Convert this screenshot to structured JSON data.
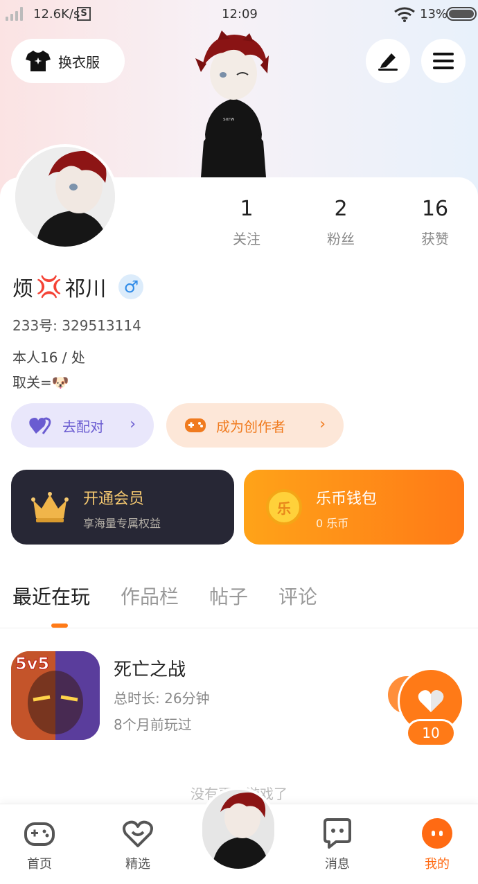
{
  "status_bar": {
    "speed": "12.6K/s",
    "s_badge": "S",
    "time": "12:09",
    "battery": "13%"
  },
  "header": {
    "outfit_label": "换衣服"
  },
  "stats": [
    {
      "num": "1",
      "label": "关注"
    },
    {
      "num": "2",
      "label": "粉丝"
    },
    {
      "num": "16",
      "label": "获赞"
    }
  ],
  "profile": {
    "name_part1": "烦",
    "name_emoji": "💢",
    "name_part2": "祁川",
    "gender_symbol": "♂",
    "id_text": "233号: 329513114",
    "bio_line1": "本人16 / 处",
    "bio_line2": "取关=",
    "bio_emoji": "🐶"
  },
  "actions": {
    "pair_label": "去配对",
    "creator_label": "成为创作者",
    "chevron": "›"
  },
  "cards": {
    "vip_title": "开通会员",
    "vip_sub": "享海量专属权益",
    "wallet_title": "乐币钱包",
    "wallet_sub": "0 乐币",
    "wallet_coin": "乐"
  },
  "tabs": [
    "最近在玩",
    "作品栏",
    "帖子",
    "评论"
  ],
  "game": {
    "title": "死亡之战",
    "duration": "总时长: 26分钟",
    "last_played": "8个月前玩过",
    "icon_text": "5v5",
    "likes": "10"
  },
  "footer_text": "没有更多游戏了",
  "bottom_nav": {
    "home": "首页",
    "featured": "精选",
    "messages": "消息",
    "mine": "我的"
  },
  "colors": {
    "accent": "#ff7a17",
    "pair": "#6a5cd1",
    "vip_bg": "#272735",
    "vip_gold": "#f6c970"
  }
}
